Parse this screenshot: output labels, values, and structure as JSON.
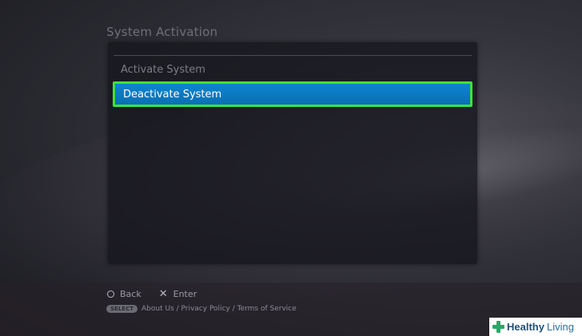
{
  "screen": {
    "title": "System Activation"
  },
  "menu": {
    "items": [
      {
        "label": "Activate System",
        "selected": false
      },
      {
        "label": "Deactivate System",
        "selected": true
      }
    ]
  },
  "footer": {
    "back_label": "Back",
    "enter_label": "Enter",
    "select_label": "SELECT",
    "links": [
      {
        "label": "About Us"
      },
      {
        "label": "Privacy Policy"
      },
      {
        "label": "Terms of Service"
      }
    ],
    "separator": " / "
  },
  "watermark": {
    "brand_bold": "Healthy",
    "brand_light": "Living",
    "icon": "plus-icon"
  },
  "colors": {
    "highlight_fill": "#0a78c0",
    "highlight_border": "#3ee23a",
    "brand_green": "#2aa76a",
    "brand_blue": "#1f4f7a"
  }
}
